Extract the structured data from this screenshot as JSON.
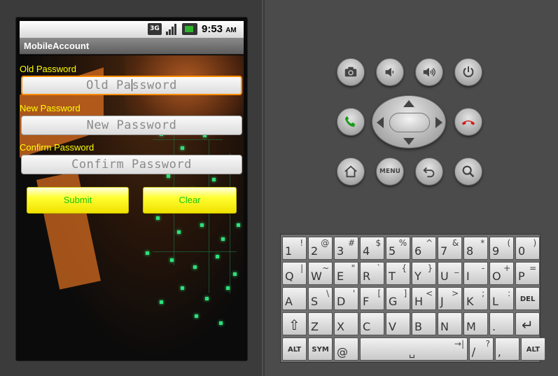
{
  "status_bar": {
    "network": "3G",
    "time": "9:53",
    "ampm": "AM"
  },
  "app": {
    "title": "MobileAccount",
    "old_password": {
      "label": "Old Password",
      "placeholder_before": "Old Pa",
      "placeholder_after": "ssword"
    },
    "new_password": {
      "label": "New Password",
      "placeholder": "New Password"
    },
    "confirm_password": {
      "label": "Confirm Password",
      "placeholder": "Confirm Password"
    },
    "submit_label": "Submit",
    "clear_label": "Clear",
    "colors": {
      "label": "#ffff00",
      "button_text": "#19c419",
      "focus": "#ff8c00"
    }
  },
  "controls": {
    "buttons": [
      "camera-icon",
      "volume-down-icon",
      "volume-up-icon",
      "power-icon",
      "call-icon",
      "end-call-icon",
      "home-icon",
      "back-icon",
      "search-icon"
    ],
    "menu_label": "MENU"
  },
  "keyboard": {
    "row1": [
      {
        "k": "1",
        "a": "!"
      },
      {
        "k": "2",
        "a": "@"
      },
      {
        "k": "3",
        "a": "#"
      },
      {
        "k": "4",
        "a": "$"
      },
      {
        "k": "5",
        "a": "%"
      },
      {
        "k": "6",
        "a": "^"
      },
      {
        "k": "7",
        "a": "&"
      },
      {
        "k": "8",
        "a": "*"
      },
      {
        "k": "9",
        "a": "("
      },
      {
        "k": "0",
        "a": ")"
      }
    ],
    "row2": [
      {
        "k": "Q",
        "a": "|"
      },
      {
        "k": "W",
        "a": "~"
      },
      {
        "k": "E",
        "a": "\""
      },
      {
        "k": "R",
        "a": "`"
      },
      {
        "k": "T",
        "a": "{"
      },
      {
        "k": "Y",
        "a": "}"
      },
      {
        "k": "U",
        "a": "_"
      },
      {
        "k": "I",
        "a": "-"
      },
      {
        "k": "O",
        "a": "+"
      },
      {
        "k": "P",
        "a": "="
      }
    ],
    "row3": [
      {
        "k": "A",
        "a": ""
      },
      {
        "k": "S",
        "a": "\\"
      },
      {
        "k": "D",
        "a": "'"
      },
      {
        "k": "F",
        "a": "["
      },
      {
        "k": "G",
        "a": "]"
      },
      {
        "k": "H",
        "a": "<"
      },
      {
        "k": "J",
        "a": ">"
      },
      {
        "k": "K",
        "a": ";"
      },
      {
        "k": "L",
        "a": ":"
      },
      {
        "k": "DEL",
        "a": ""
      }
    ],
    "row4": [
      {
        "k": "⇧",
        "a": ""
      },
      {
        "k": "Z",
        "a": ""
      },
      {
        "k": "X",
        "a": ""
      },
      {
        "k": "C",
        "a": ""
      },
      {
        "k": "V",
        "a": ""
      },
      {
        "k": "B",
        "a": ""
      },
      {
        "k": "N",
        "a": ""
      },
      {
        "k": "M",
        "a": ""
      },
      {
        "k": ".",
        "a": ""
      },
      {
        "k": "↵",
        "a": ""
      }
    ],
    "row5": [
      {
        "k": "ALT",
        "a": ""
      },
      {
        "k": "SYM",
        "a": ""
      },
      {
        "k": "@",
        "a": ""
      },
      {
        "k": "␣",
        "a": "→|"
      },
      {
        "k": "/",
        "a": "?"
      },
      {
        "k": ",",
        "a": ""
      },
      {
        "k": "ALT",
        "a": ""
      }
    ]
  }
}
